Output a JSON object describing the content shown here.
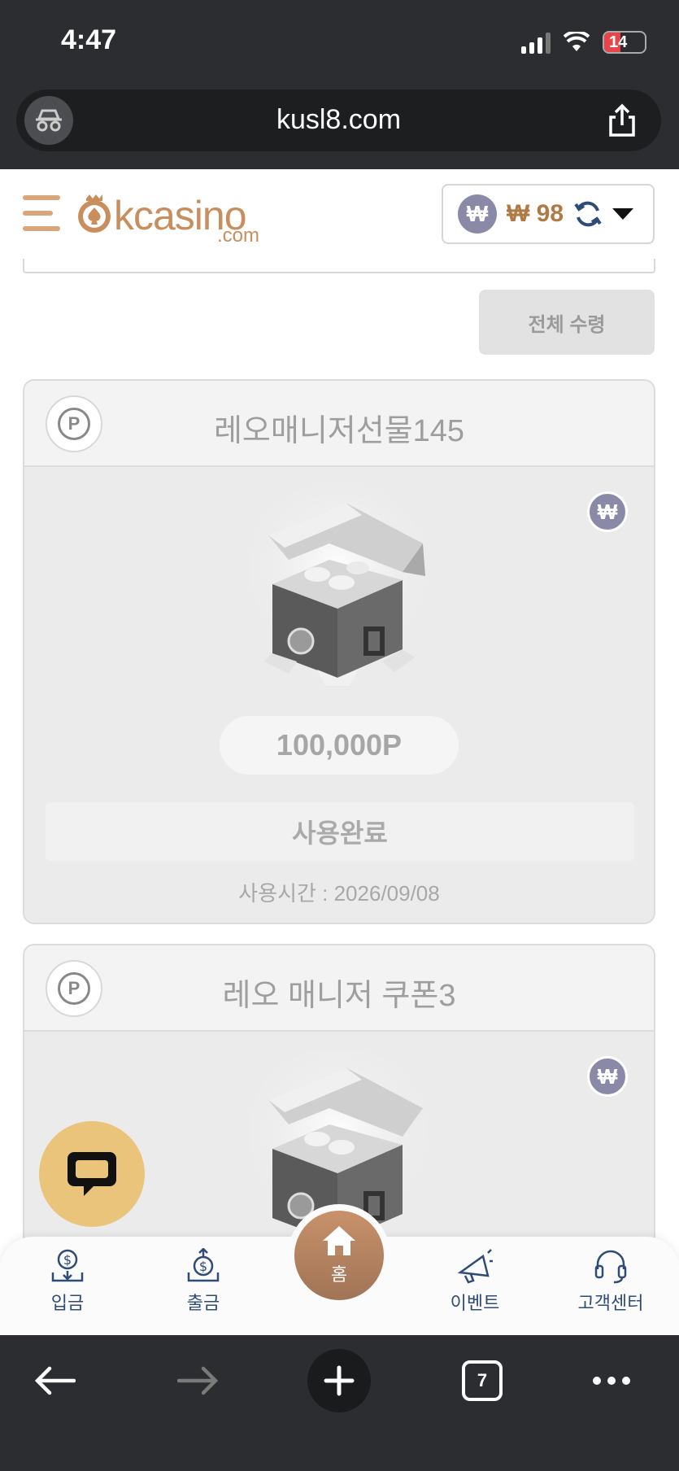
{
  "status": {
    "time": "4:47",
    "battery": "14"
  },
  "browser": {
    "url": "kusl8.com",
    "tab_count": "7"
  },
  "header": {
    "logo": "kcasino",
    "logo_sub": ".com",
    "currency_symbol": "₩",
    "balance": "₩ 98"
  },
  "actions": {
    "claim_all": "전체 수령"
  },
  "coupons": [
    {
      "title": "레오매니저선물145",
      "points": "100,000P",
      "status": "사용완료",
      "used_time": "사용시간 : 2026/09/08"
    },
    {
      "title": "레오 매니저 쿠폰3"
    }
  ],
  "bottom_nav": {
    "deposit": "입금",
    "withdraw": "출금",
    "home": "홈",
    "events": "이벤트",
    "support": "고객센터"
  },
  "colors": {
    "accent": "#c98e5d",
    "nav_text": "#2f4b78",
    "chat_fab": "#e9c47a"
  }
}
